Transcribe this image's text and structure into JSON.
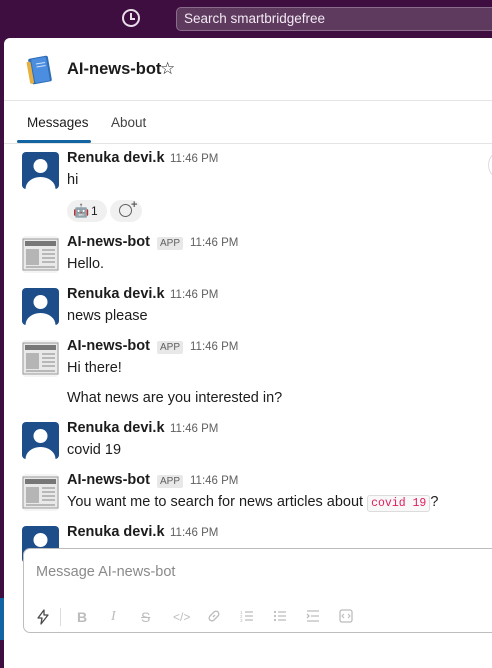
{
  "topbar": {
    "search_label": "Search smartbridgefree",
    "history_icon": "clock-icon"
  },
  "channel": {
    "title": "AI-news-bot",
    "star_glyph": "☆"
  },
  "tabs": [
    {
      "label": "Messages",
      "active": true
    },
    {
      "label": "About",
      "active": false
    }
  ],
  "messages": [
    {
      "author": "Renuka devi.k",
      "type": "user",
      "app": false,
      "time": "11:46 PM",
      "lines": [
        "hi"
      ],
      "reaction": {
        "emoji": "🤖",
        "count": "1"
      }
    },
    {
      "author": "AI-news-bot",
      "type": "bot",
      "app": true,
      "app_label": "APP",
      "time": "11:46 PM",
      "lines": [
        "Hello."
      ]
    },
    {
      "author": "Renuka devi.k",
      "type": "user",
      "app": false,
      "time": "11:46 PM",
      "lines": [
        "news please"
      ]
    },
    {
      "author": "AI-news-bot",
      "type": "bot",
      "app": true,
      "app_label": "APP",
      "time": "11:46 PM",
      "lines": [
        "Hi there!",
        "What news are you interested in?"
      ]
    },
    {
      "author": "Renuka devi.k",
      "type": "user",
      "app": false,
      "time": "11:46 PM",
      "lines": [
        "covid 19"
      ]
    },
    {
      "author": "AI-news-bot",
      "type": "bot",
      "app": true,
      "app_label": "APP",
      "time": "11:46 PM",
      "text_before": "You want me to search for news articles about ",
      "code": "covid 19",
      "text_after": "?"
    },
    {
      "author": "Renuka devi.k",
      "type": "user",
      "app": false,
      "time": "11:46 PM",
      "lines": []
    }
  ],
  "composer": {
    "placeholder": "Message AI-news-bot",
    "toolbar_icons": [
      "lightning-icon",
      "bold-icon",
      "italic-icon",
      "strikethrough-icon",
      "code-icon",
      "link-icon",
      "ordered-list-icon",
      "bulleted-list-icon",
      "indent-icon",
      "code-block-icon"
    ]
  },
  "colors": {
    "sidebar": "#3f0e40",
    "accent": "#1264a3",
    "code_text": "#e01e5a"
  }
}
